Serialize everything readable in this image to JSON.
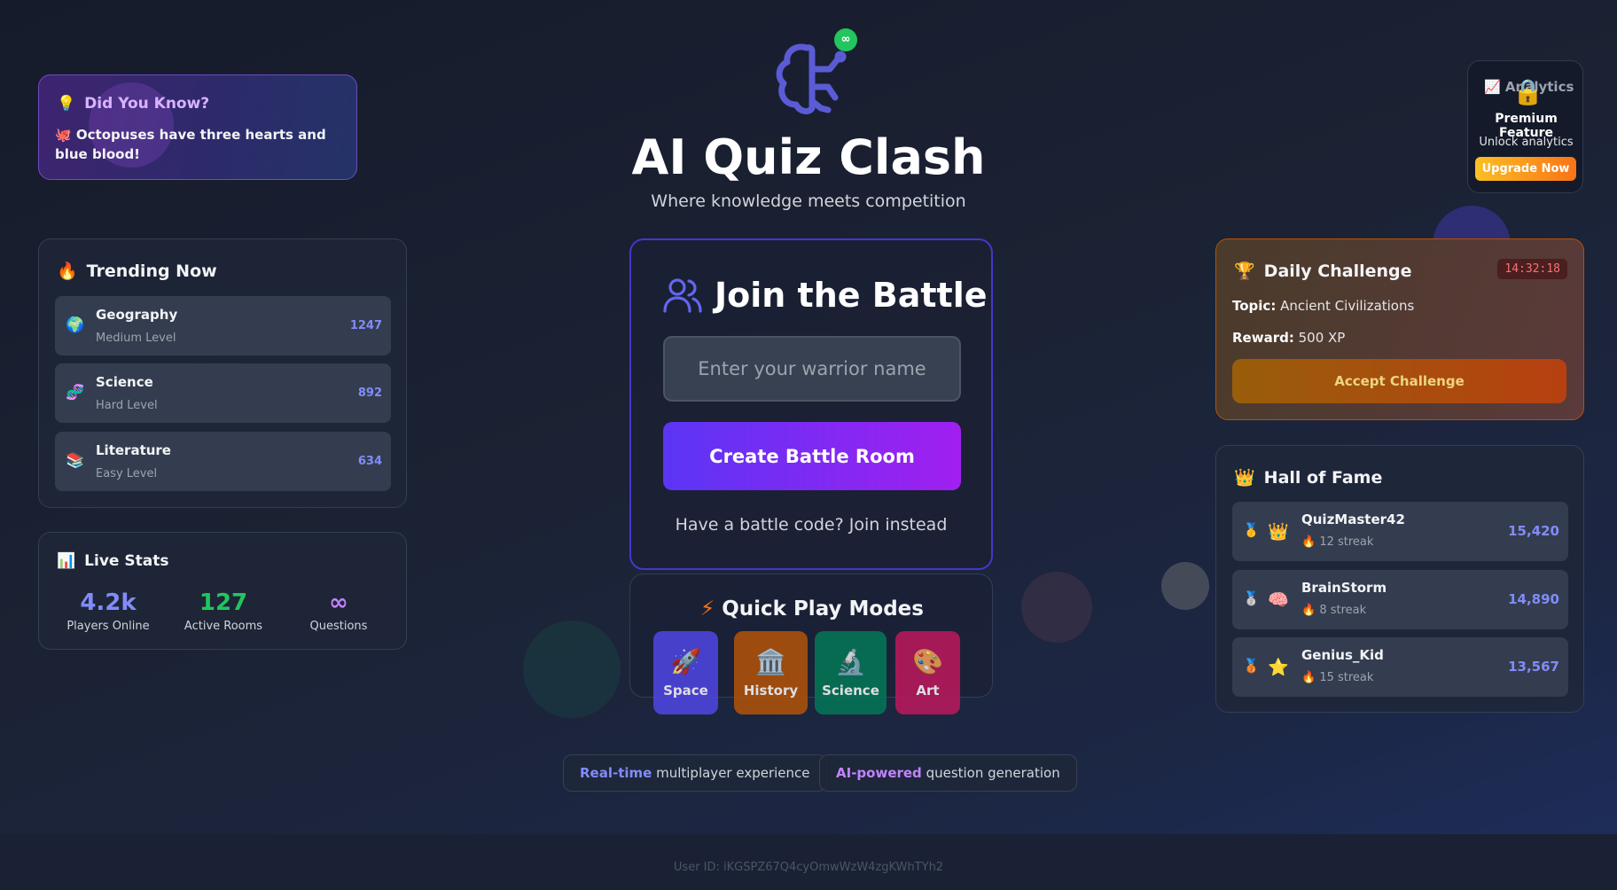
{
  "fact": {
    "title": "Did You Know?",
    "text": "🐙 Octopuses have three hearts and blue blood!"
  },
  "trending": {
    "title": "Trending Now",
    "items": [
      {
        "icon": "🌍",
        "name": "Geography",
        "level": "Medium Level",
        "count": "1247"
      },
      {
        "icon": "🧬",
        "name": "Science",
        "level": "Hard Level",
        "count": "892"
      },
      {
        "icon": "📚",
        "name": "Literature",
        "level": "Easy Level",
        "count": "634"
      }
    ]
  },
  "stats": {
    "title": "Live Stats",
    "items": [
      {
        "value": "4.2k",
        "label": "Players Online",
        "color": "#818cf8"
      },
      {
        "value": "127",
        "label": "Active Rooms",
        "color": "#22c55e"
      },
      {
        "value": "∞",
        "label": "Questions",
        "color": "#c084fc"
      }
    ]
  },
  "header": {
    "badge": "∞",
    "title": "AI Quiz Clash",
    "subtitle": "Where knowledge meets competition"
  },
  "join": {
    "title": "Join the Battle",
    "name_placeholder": "Enter your warrior name",
    "create_button": "Create Battle Room",
    "join_link": "Have a battle code? Join instead"
  },
  "quick_play": {
    "title": "Quick Play Modes",
    "modes": [
      {
        "icon": "🚀",
        "label": "Space",
        "color": "#4f46e5"
      },
      {
        "icon": "🏛️",
        "label": "History",
        "color": "#b45309"
      },
      {
        "icon": "🔬",
        "label": "Science",
        "color": "#047857"
      },
      {
        "icon": "🎨",
        "label": "Art",
        "color": "#be185d"
      }
    ]
  },
  "features": [
    {
      "highlight": "Real-time",
      "text": " multiplayer experience",
      "color": "#818cf8"
    },
    {
      "highlight": "AI-powered",
      "text": " question generation",
      "color": "#c084fc"
    }
  ],
  "user_id": "User ID: iKGSPZ67Q4cyOmwWzW4zgKWhTYh2",
  "analytics": {
    "title": "Analytics",
    "premium": "Premium Feature",
    "unlock": "Unlock analytics",
    "button": "Upgrade Now"
  },
  "daily": {
    "title": "Daily Challenge",
    "timer": "14:32:18",
    "topic_label": "Topic:",
    "topic": "Ancient Civilizations",
    "reward_label": "Reward:",
    "reward": "500 XP",
    "button": "Accept Challenge"
  },
  "hall_of_fame": {
    "title": "Hall of Fame",
    "players": [
      {
        "medal": "🥇",
        "avatar": "👑",
        "name": "QuizMaster42",
        "streak": "🔥 12 streak",
        "score": "15,420"
      },
      {
        "medal": "🥈",
        "avatar": "🧠",
        "name": "BrainStorm",
        "streak": "🔥 8 streak",
        "score": "14,890"
      },
      {
        "medal": "🥉",
        "avatar": "⭐",
        "name": "Genius_Kid",
        "streak": "🔥 15 streak",
        "score": "13,567"
      }
    ]
  }
}
